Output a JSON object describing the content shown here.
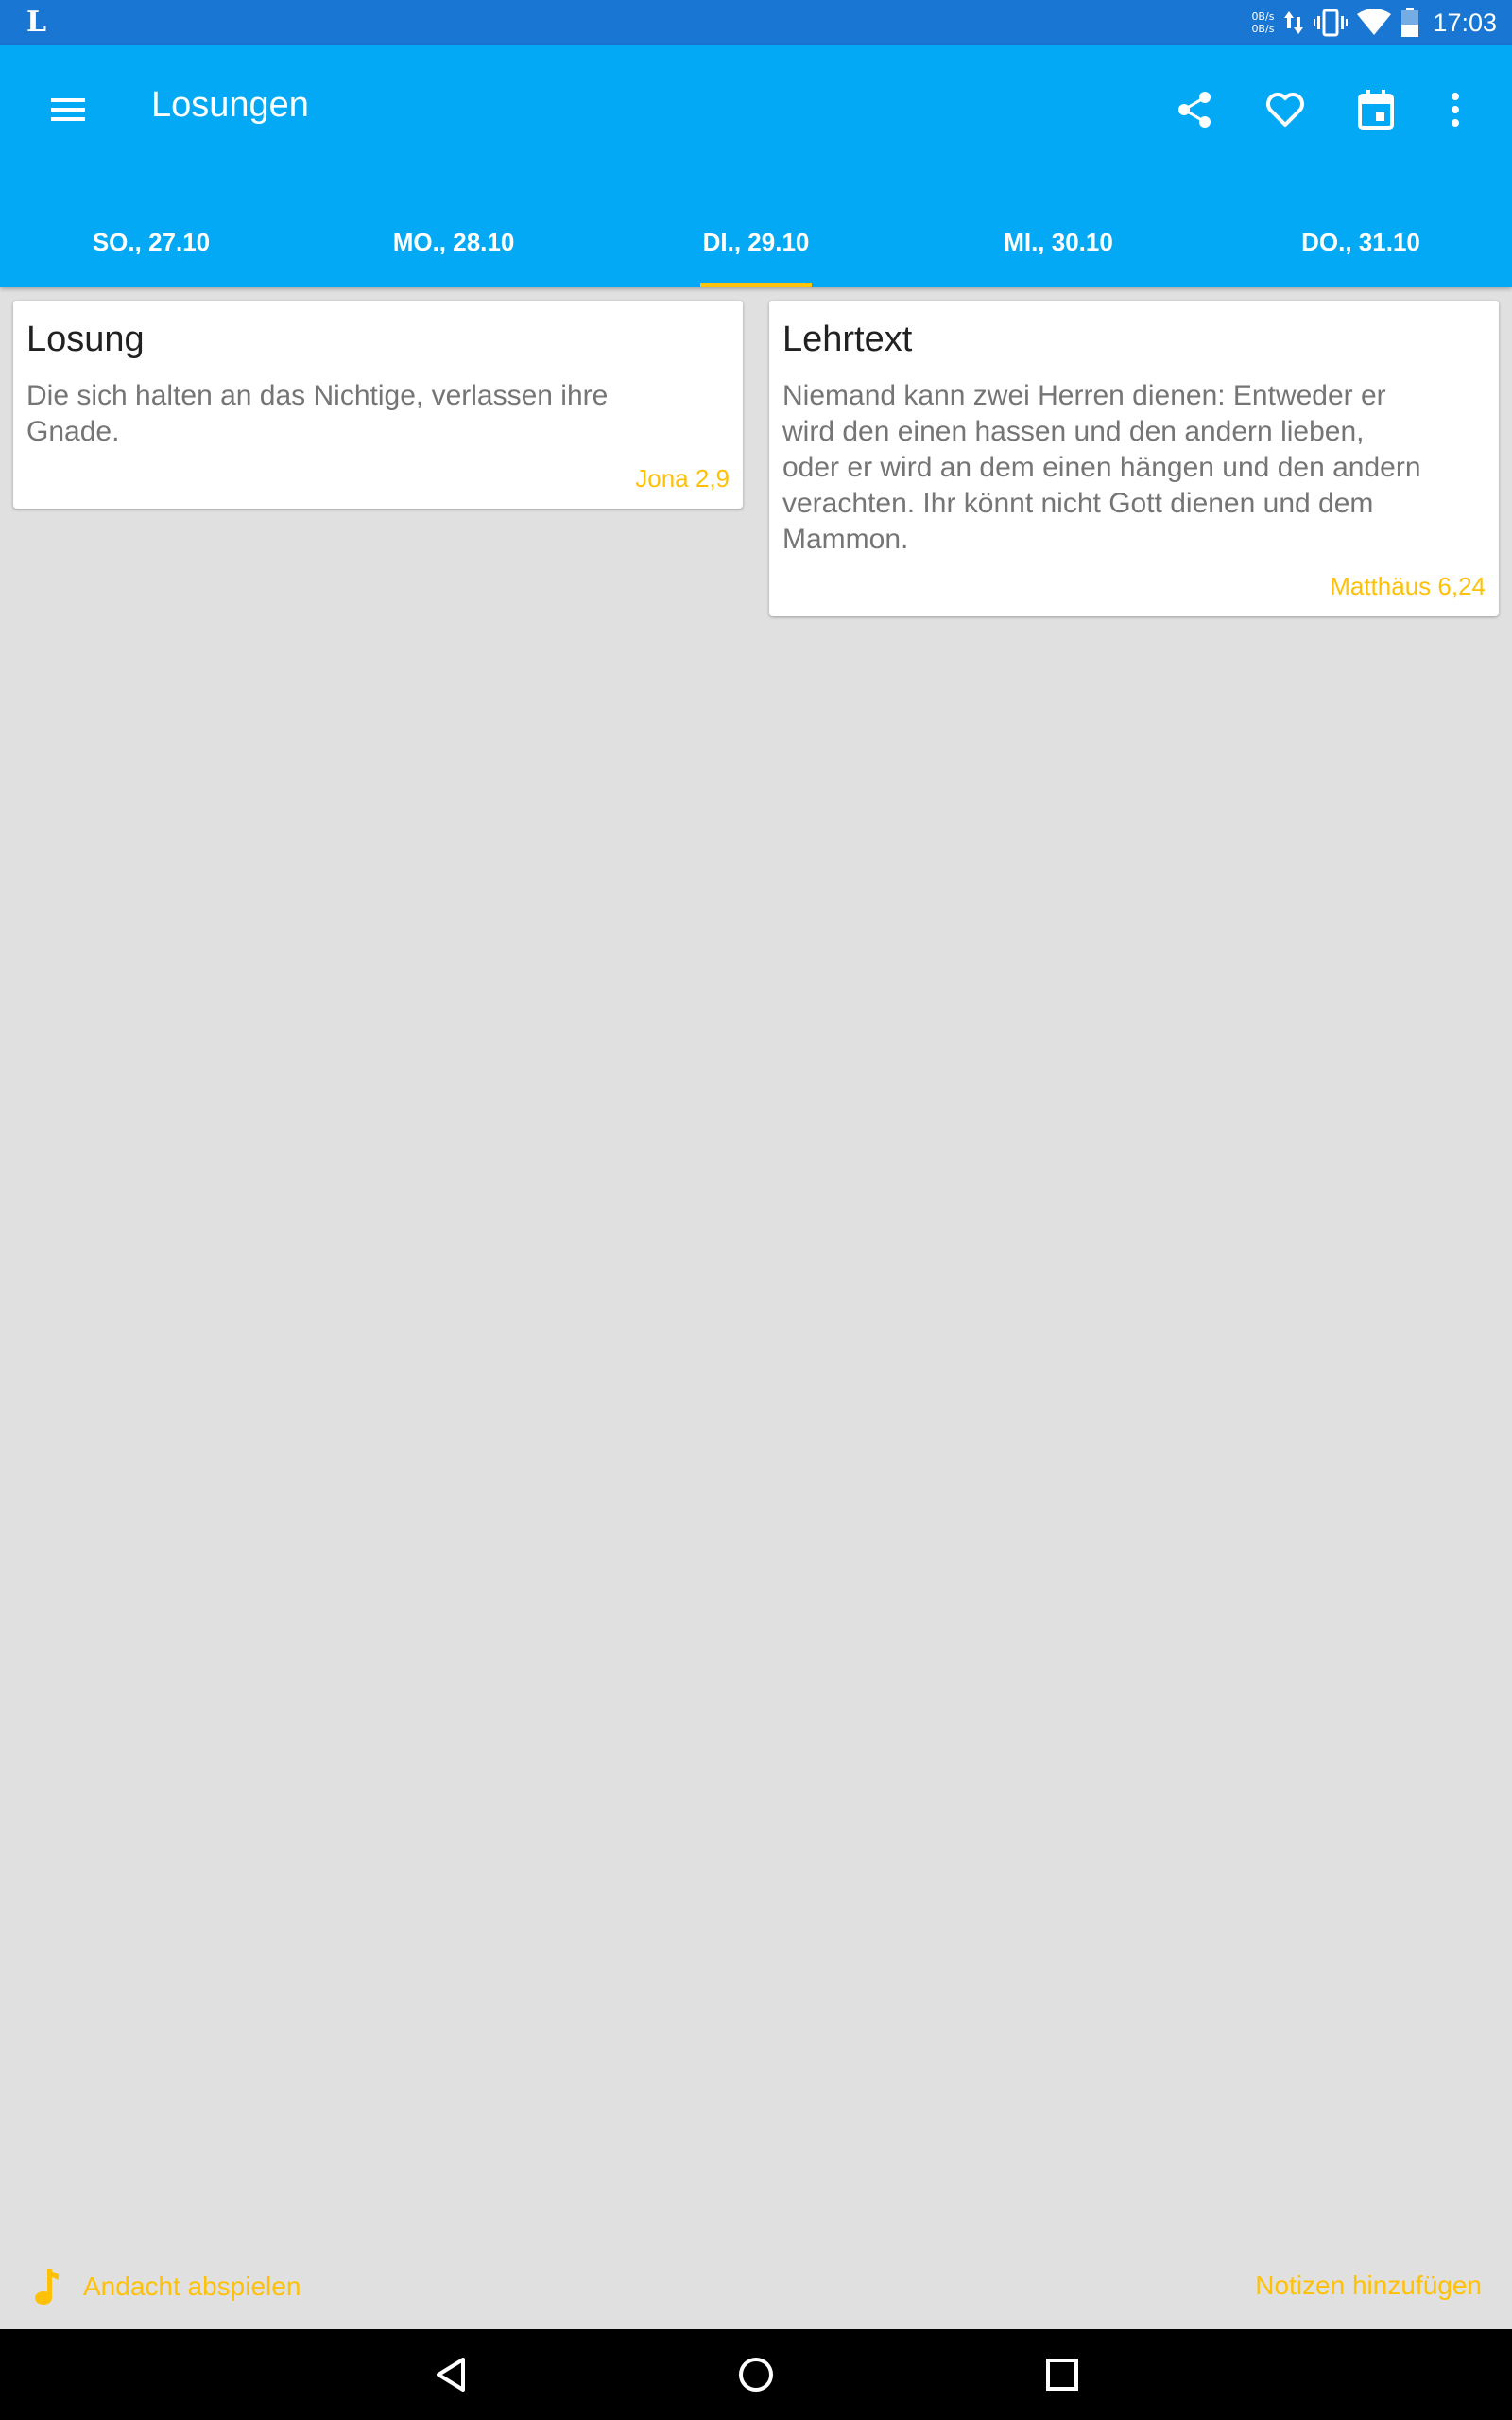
{
  "status_bar": {
    "app_letter": "L",
    "net_up": "0B/s",
    "net_down": "0B/s",
    "time": "17:03",
    "icons": [
      "data-arrows-icon",
      "vibrate-icon",
      "wifi-icon",
      "battery-icon"
    ]
  },
  "app_bar": {
    "title": "Losungen",
    "actions": [
      "share-icon",
      "heart-icon",
      "calendar-icon",
      "more-vert-icon"
    ]
  },
  "tabs": [
    {
      "label": "SO., 27.10",
      "active": false
    },
    {
      "label": "MO., 28.10",
      "active": false
    },
    {
      "label": "DI., 29.10",
      "active": true
    },
    {
      "label": "MI., 30.10",
      "active": false
    },
    {
      "label": "DO., 31.10",
      "active": false
    }
  ],
  "losung": {
    "title": "Losung",
    "text_lines": [
      "Die sich halten an das Nichtige, verlassen ihre",
      "Gnade."
    ],
    "reference": "Jona 2,9"
  },
  "lehrtext": {
    "title": "Lehrtext",
    "text_lines": [
      "Niemand kann zwei Herren dienen: Entweder er",
      "wird den einen hassen und den andern lieben,",
      "oder er wird an dem einen hängen und den andern",
      "verachten. Ihr könnt nicht Gott dienen und dem",
      "Mammon."
    ],
    "reference": "Matthäus 6,24"
  },
  "bottom": {
    "play_label": "Andacht abspielen",
    "notes_label": "Notizen hinzufügen"
  },
  "colors": {
    "status_bar": "#1976d2",
    "primary": "#03a9f4",
    "accent": "#ffc107",
    "background": "#e0e0e0"
  }
}
